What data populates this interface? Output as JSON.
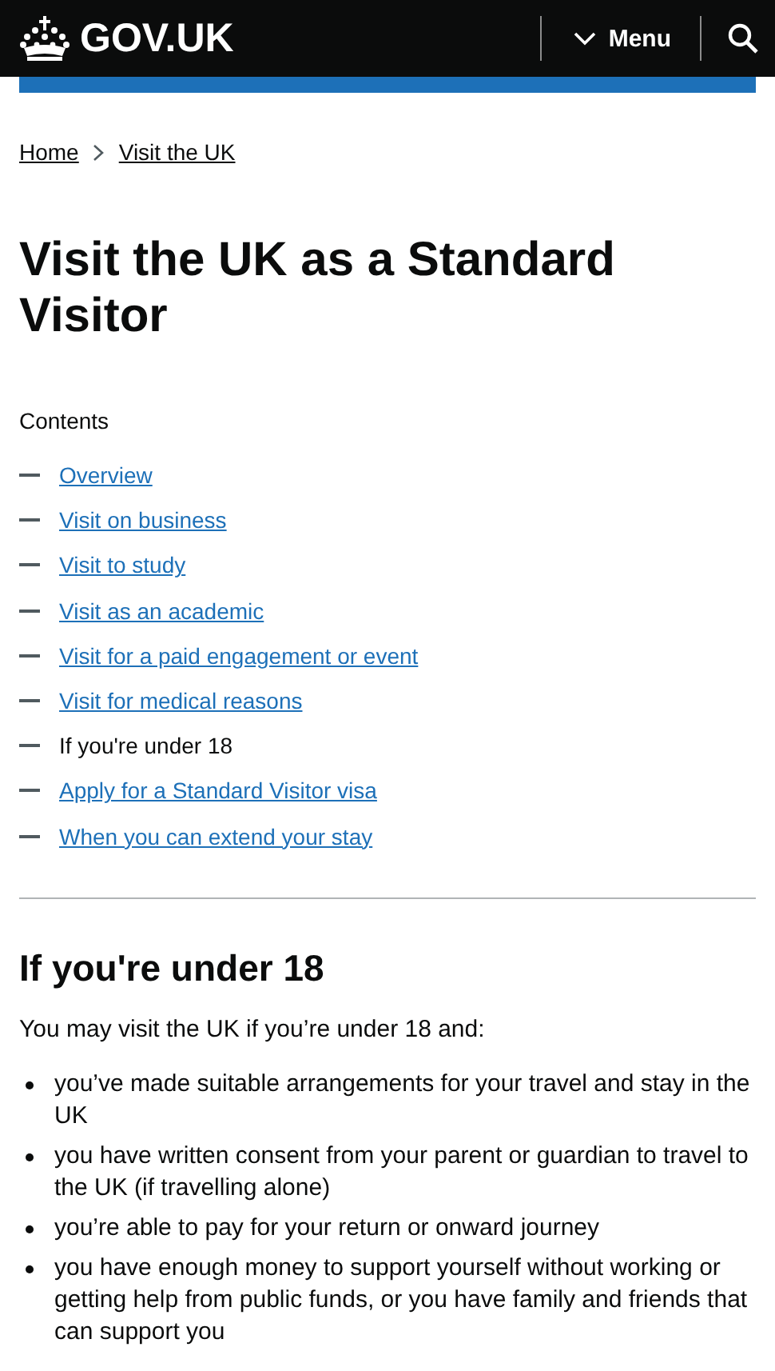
{
  "header": {
    "logo": "GOV.UK",
    "menu": "Menu"
  },
  "breadcrumbs": [
    "Home",
    "Visit the UK"
  ],
  "title": "Visit the UK as a Standard Visitor",
  "contents": {
    "heading": "Contents",
    "items": [
      {
        "label": "Overview",
        "selected": false
      },
      {
        "label": "Visit on business",
        "selected": false
      },
      {
        "label": "Visit to study",
        "selected": false
      },
      {
        "label": "Visit as an academic",
        "selected": false
      },
      {
        "label": "Visit for a paid engagement or event",
        "selected": false
      },
      {
        "label": "Visit for medical reasons",
        "selected": false
      },
      {
        "label": "If you're under 18",
        "selected": true
      },
      {
        "label": "Apply for a Standard Visitor visa",
        "selected": false
      },
      {
        "label": "When you can extend your stay",
        "selected": false
      }
    ]
  },
  "section": {
    "heading": "If you're under 18",
    "intro": "You may visit the UK if you’re under 18 and:",
    "bullets": [
      "you’ve made suitable arrangements for your travel and stay in the UK",
      "you have written consent from your parent or guardian to travel to the UK (if travelling alone)",
      "you’re able to pay for your return or onward journey",
      "you have enough money to support yourself without working or getting help from public funds, or you have family and friends that can support you"
    ]
  }
}
